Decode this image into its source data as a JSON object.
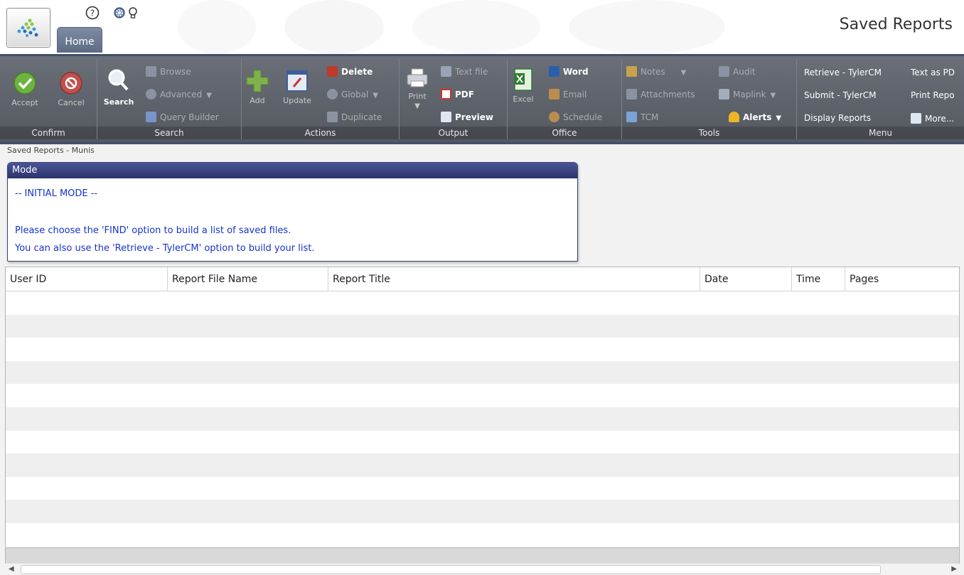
{
  "header": {
    "home_tab": "Home",
    "page_heading": "Saved Reports",
    "icons": [
      "help-icon",
      "settings-gear-icon",
      "lightbulb-icon"
    ]
  },
  "ribbon": {
    "confirm": {
      "label": "Confirm",
      "accept": "Accept",
      "cancel": "Cancel"
    },
    "search": {
      "label": "Search",
      "search": "Search",
      "browse": "Browse",
      "advanced": "Advanced",
      "query_builder": "Query Builder"
    },
    "actions": {
      "label": "Actions",
      "add": "Add",
      "update": "Update",
      "delete": "Delete",
      "global": "Global",
      "duplicate": "Duplicate"
    },
    "output": {
      "label": "Output",
      "print": "Print",
      "text_file": "Text file",
      "pdf": "PDF",
      "preview": "Preview"
    },
    "office": {
      "label": "Office",
      "excel": "Excel",
      "word": "Word",
      "email": "Email",
      "schedule": "Schedule"
    },
    "tools": {
      "label": "Tools",
      "notes": "Notes",
      "attachments": "Attachments",
      "tcm": "TCM",
      "audit": "Audit",
      "maplink": "Maplink",
      "alerts": "Alerts"
    },
    "menu": {
      "label": "Menu",
      "retrieve": "Retrieve - TylerCM",
      "submit": "Submit - TylerCM",
      "display_reports": "Display Reports",
      "text_as_pdf": "Text as PD",
      "print_report": "Print Repo",
      "more": "More..."
    }
  },
  "breadcrumb": "Saved Reports - Munis",
  "mode_panel": {
    "title": "Mode",
    "line1": "-- INITIAL MODE --",
    "line2": "Please choose the 'FIND' option to build a list of saved files.",
    "line3": "You can also use the 'Retrieve - TylerCM' option to build your list."
  },
  "grid": {
    "columns": [
      "User ID",
      "Report File Name",
      "Report Title",
      "Date",
      "Time",
      "Pages"
    ],
    "rows": []
  },
  "colors": {
    "ribbon_bg": "#5f636b",
    "mode_title_bg": "#2f3770",
    "mode_text": "#1533cc",
    "accept_green": "#6db33f",
    "cancel_red": "#c0504d"
  }
}
